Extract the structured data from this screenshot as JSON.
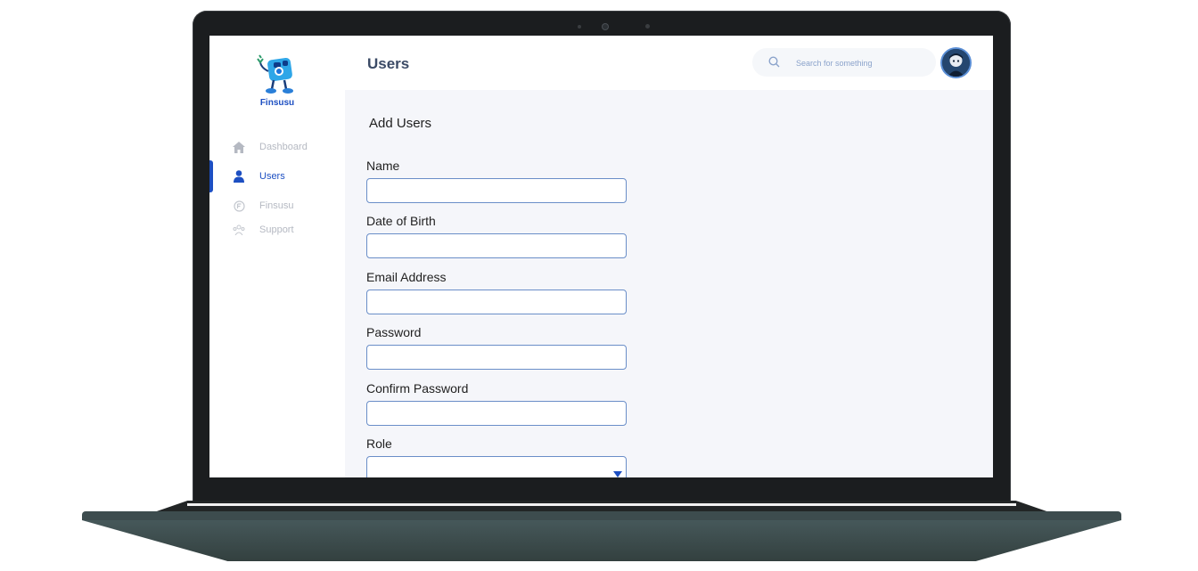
{
  "app": {
    "brand": "Finsusu",
    "page_title": "Users"
  },
  "sidebar": {
    "items": [
      {
        "label": "Dashboard",
        "icon": "home-icon",
        "active": false
      },
      {
        "label": "Users",
        "icon": "user-icon",
        "active": true
      },
      {
        "label": "Finsusu",
        "icon": "finsusu-icon",
        "active": false
      },
      {
        "label": "Support",
        "icon": "support-icon",
        "active": false
      }
    ]
  },
  "search": {
    "placeholder": "Search for something"
  },
  "form": {
    "title": "Add Users",
    "fields": [
      {
        "label": "Name",
        "value": ""
      },
      {
        "label": "Date of Birth",
        "value": ""
      },
      {
        "label": "Email Address",
        "value": ""
      },
      {
        "label": "Password",
        "value": ""
      },
      {
        "label": "Confirm Password",
        "value": ""
      },
      {
        "label": "Role",
        "value": ""
      }
    ]
  },
  "colors": {
    "accent": "#1d4fc2",
    "background": "#f5f6fa",
    "input_border": "#6a8ec8",
    "laptop_base": "#3d4c4e"
  }
}
